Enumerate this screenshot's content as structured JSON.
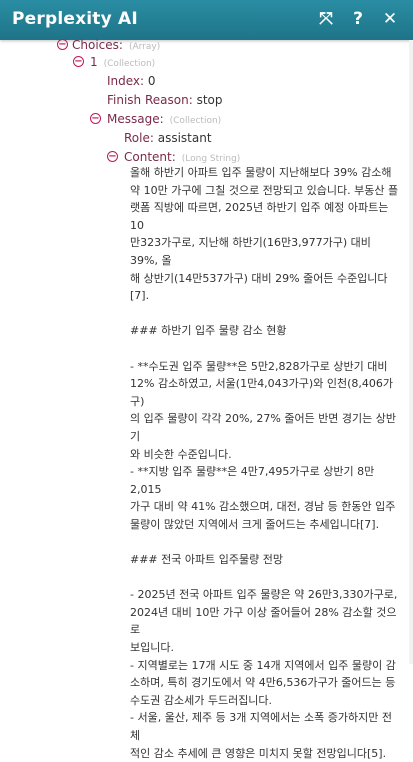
{
  "header": {
    "title": "Perplexity AI",
    "icons": [
      "expand-icon",
      "help-icon",
      "close-icon"
    ],
    "expand_glyph": "⤧",
    "help_glyph": "?",
    "close_glyph": "✕"
  },
  "tree": {
    "choices_key": "Choices:",
    "choices_type": "(Array)",
    "item_key": "1",
    "item_type": "(Collection)",
    "index_key": "Index:",
    "index_val": "0",
    "finish_key": "Finish Reason:",
    "finish_val": "stop",
    "message_key": "Message:",
    "message_type": "(Collection)",
    "role_key": "Role:",
    "role_val": "assistant",
    "content_key": "Content:",
    "content_type": "(Long String)"
  },
  "content_text": "올해 하반기 아파트 입주 물량이 지난해보다 39% 감소해\n약 10만 가구에 그칠 것으로 전망되고 있습니다. 부동산 플\n랫폼 직방에 따르면, 2025년 하반기 입주 예정 아파트는 10\n만323가구로, 지난해 하반기(16만3,977가구) 대비 39%, 올\n해 상반기(14만537가구) 대비 29% 줄어든 수준입니다[7].\n\n### 하반기 입주 물량 감소 현황\n\n- **수도권 입주 물량**은 5만2,828가구로 상반기 대비\n12% 감소하였고, 서울(1만4,043가구)와 인천(8,406가구)\n의 입주 물량이 각각 20%, 27% 줄어든 반면 경기는 상반기\n와 비슷한 수준입니다.\n- **지방 입주 물량**은 4만7,495가구로 상반기 8만2,015\n가구 대비 약 41% 감소했으며, 대전, 경남 등 한동안 입주\n물량이 많았던 지역에서 크게 줄어드는 추세입니다[7].\n\n### 전국 아파트 입주물량 전망\n\n- 2025년 전국 아파트 입주 물량은 약 26만3,330가구로,\n2024년 대비 10만 가구 이상 줄어들어 28% 감소할 것으로\n보입니다.\n- 지역별로는 17개 시도 중 14개 지역에서 입주 물량이 감\n소하며, 특히 경기도에서 약 4만6,536가구가 줄어드는 등\n수도권 감소세가 두드러집니다.\n- 서울, 울산, 제주 등 3개 지역에서는 소폭 증가하지만 전체\n적인 감소 추세에 큰 영향은 미치지 못할 전망입니다[5]."
}
